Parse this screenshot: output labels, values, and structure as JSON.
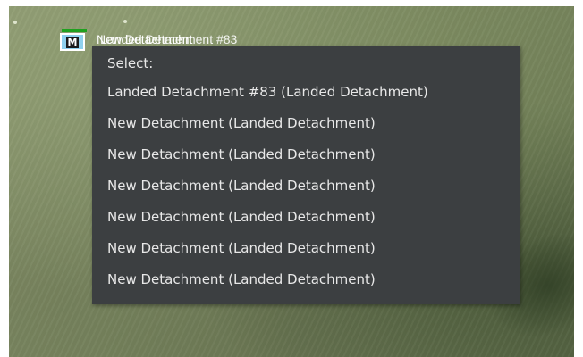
{
  "unit": {
    "symbol_letter": "M",
    "label_primary": "New Detachment",
    "label_overlap": "Landed Detachment #83",
    "health_color": "#1fa11f",
    "symbol_color": "#8fd1ee"
  },
  "menu": {
    "header": "Select:",
    "items": [
      {
        "label": "Landed Detachment #83 (Landed Detachment)"
      },
      {
        "label": "New Detachment (Landed Detachment)"
      },
      {
        "label": "New Detachment (Landed Detachment)"
      },
      {
        "label": "New Detachment (Landed Detachment)"
      },
      {
        "label": "New Detachment (Landed Detachment)"
      },
      {
        "label": "New Detachment (Landed Detachment)"
      },
      {
        "label": "New Detachment (Landed Detachment)"
      }
    ]
  }
}
